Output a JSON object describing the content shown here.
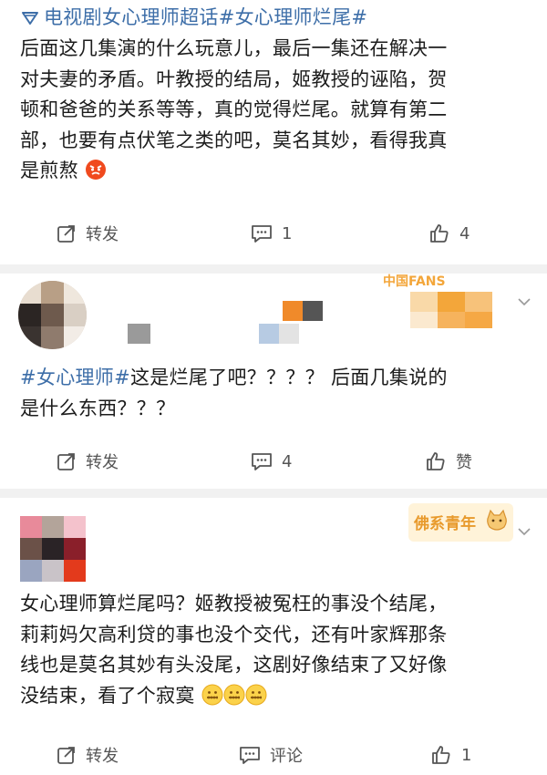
{
  "post1": {
    "topic1": "电视剧女心理师超话",
    "topic2": "#女心理师烂尾#",
    "body_lines": [
      "后面这几集演的什么玩意儿，最后一集还在解决一",
      "对夫妻的矛盾。叶教授的结局，姬教授的诬陷，贺",
      "顿和爸爸的关系等等，真的觉得烂尾。就算有第二",
      "部，也要有点伏笔之类的吧，莫名其妙，看得我真",
      "是煎熬"
    ],
    "repost_label": "转发",
    "comment_count": "1",
    "like_count": "4"
  },
  "post2": {
    "topic": "#女心理师#",
    "line1_rest": "这是烂尾了吧？？？？ 后面几集说的",
    "line2": "是什么东西？？？",
    "repost_label": "转发",
    "comment_count": "4",
    "like_label": "赞",
    "badge_text": "中国FANS"
  },
  "post3": {
    "body_lines": [
      "女心理师算烂尾吗？姬教授被冤枉的事没个结尾，",
      "莉莉妈欠高利贷的事也没个交代，还有叶家辉那条",
      "线也是莫名其妙有头没尾，这剧好像结束了又好像",
      "没结束，看了个寂寞"
    ],
    "repost_label": "转发",
    "comment_label": "评论",
    "like_count": "1",
    "badge_text": "佛系青年"
  },
  "colors": {
    "topic_blue": "#3d6ea8",
    "badge_orange": "#f3a63a"
  }
}
